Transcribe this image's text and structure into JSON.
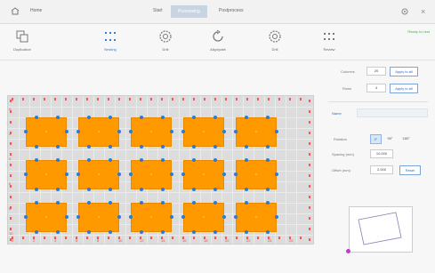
{
  "header": {
    "home_label": "Home",
    "tabs": [
      {
        "label": "Start"
      },
      {
        "label": "Processing",
        "active": true
      },
      {
        "label": "Postprocess"
      }
    ]
  },
  "toolbar": {
    "tools": [
      {
        "label": "Duplication",
        "icon": "duplicate-icon"
      },
      {
        "label": "Nesting",
        "icon": "nesting-icon",
        "active": true
      },
      {
        "label": "Drill",
        "icon": "gear-icon"
      },
      {
        "label": "Align/path",
        "icon": "rotate-icon"
      },
      {
        "label": "Drill",
        "icon": "gear-icon"
      },
      {
        "label": "Review",
        "icon": "dots-icon"
      }
    ],
    "status": "Ready to nest"
  },
  "canvas": {
    "sheet_label": "1",
    "x_ticks": [
      "0",
      "2",
      "4",
      "6",
      "8",
      "10",
      "12",
      "14",
      "16",
      "18",
      "20",
      "22",
      "24",
      "26"
    ],
    "y_ticks": [
      "0",
      "2",
      "4",
      "6",
      "8",
      "10"
    ]
  },
  "panel": {
    "columns_label": "Columns",
    "columns_value": "20",
    "rows_label": "Rows",
    "rows_value": "4",
    "apply_label": "Apply to all",
    "name_label": "Name",
    "rotation_label": "Rotation",
    "rotation_options": [
      "0°",
      "90°",
      "180°"
    ],
    "spacing_x_label": "Spacing (mm)",
    "spacing_x_value": "10.000",
    "offset_label": "Offset (mm)",
    "offset_value": "2.000",
    "reset_label": "Reset"
  },
  "colors": {
    "sheet": "#ff9900",
    "accent": "#2f7fd7",
    "anchor": "#2e79d6",
    "edge_marker": "#ef5a5a"
  }
}
